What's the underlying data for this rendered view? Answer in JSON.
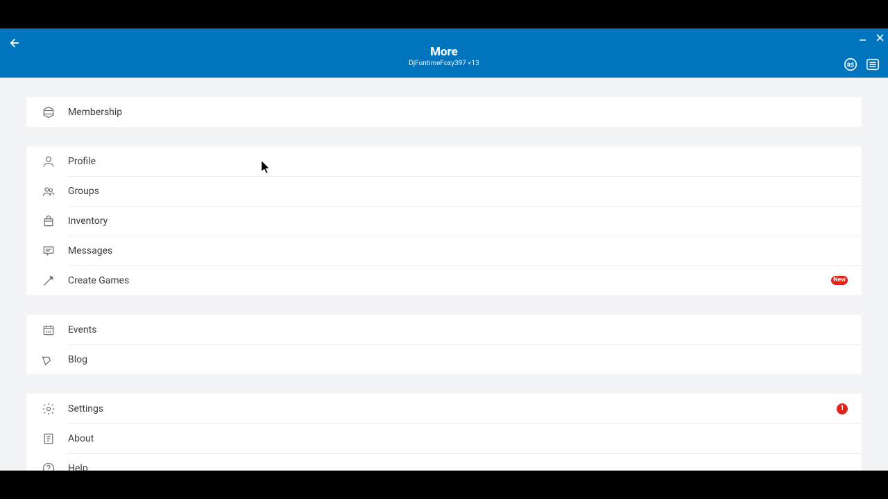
{
  "header": {
    "title": "More",
    "subtitle": "DjFuntimeFoxy397 <13"
  },
  "sections": [
    {
      "rows": [
        {
          "label": "Membership",
          "icon": "membership"
        }
      ]
    },
    {
      "rows": [
        {
          "label": "Profile",
          "icon": "profile"
        },
        {
          "label": "Groups",
          "icon": "groups"
        },
        {
          "label": "Inventory",
          "icon": "inventory"
        },
        {
          "label": "Messages",
          "icon": "messages"
        },
        {
          "label": "Create Games",
          "icon": "create",
          "new_label": "New"
        }
      ]
    },
    {
      "rows": [
        {
          "label": "Events",
          "icon": "events"
        },
        {
          "label": "Blog",
          "icon": "blog"
        }
      ]
    },
    {
      "rows": [
        {
          "label": "Settings",
          "icon": "settings",
          "badge": "1"
        },
        {
          "label": "About",
          "icon": "about"
        },
        {
          "label": "Help",
          "icon": "help"
        }
      ]
    }
  ]
}
